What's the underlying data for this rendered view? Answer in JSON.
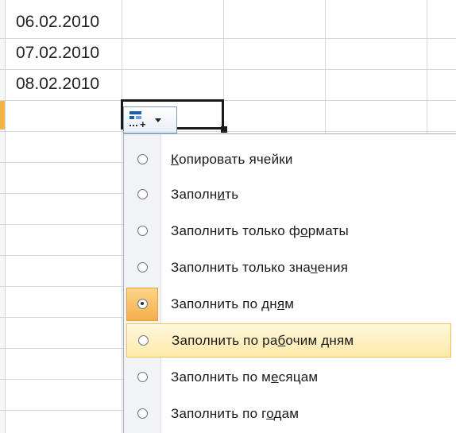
{
  "cells": {
    "dates": [
      "06.02.2010",
      "07.02.2010",
      "08.02.2010"
    ]
  },
  "autofill_button": {
    "icon": "autofill-options-icon",
    "caret": "chevron-down-icon"
  },
  "menu": {
    "items": [
      {
        "pre": "",
        "acc": "К",
        "post": "опировать ячейки",
        "checked": false,
        "hover": false
      },
      {
        "pre": "Заполн",
        "acc": "и",
        "post": "ть",
        "checked": false,
        "hover": false
      },
      {
        "pre": "Заполнить только ф",
        "acc": "о",
        "post": "рматы",
        "checked": false,
        "hover": false
      },
      {
        "pre": "Заполнить только зна",
        "acc": "ч",
        "post": "ения",
        "checked": false,
        "hover": false
      },
      {
        "pre": "Заполнить по дн",
        "acc": "я",
        "post": "м",
        "checked": true,
        "hover": false
      },
      {
        "pre": "Заполнить по ра",
        "acc": "б",
        "post": "очим дням",
        "checked": false,
        "hover": true
      },
      {
        "pre": "Заполнить по м",
        "acc": "е",
        "post": "сяцам",
        "checked": false,
        "hover": false
      },
      {
        "pre": "Заполнить по г",
        "acc": "о",
        "post": "дам",
        "checked": false,
        "hover": false
      }
    ]
  },
  "colors": {
    "highlight": "#ffe9a8",
    "checked_bg": "#f6ae4a",
    "selection_border": "#1a1a1a"
  }
}
